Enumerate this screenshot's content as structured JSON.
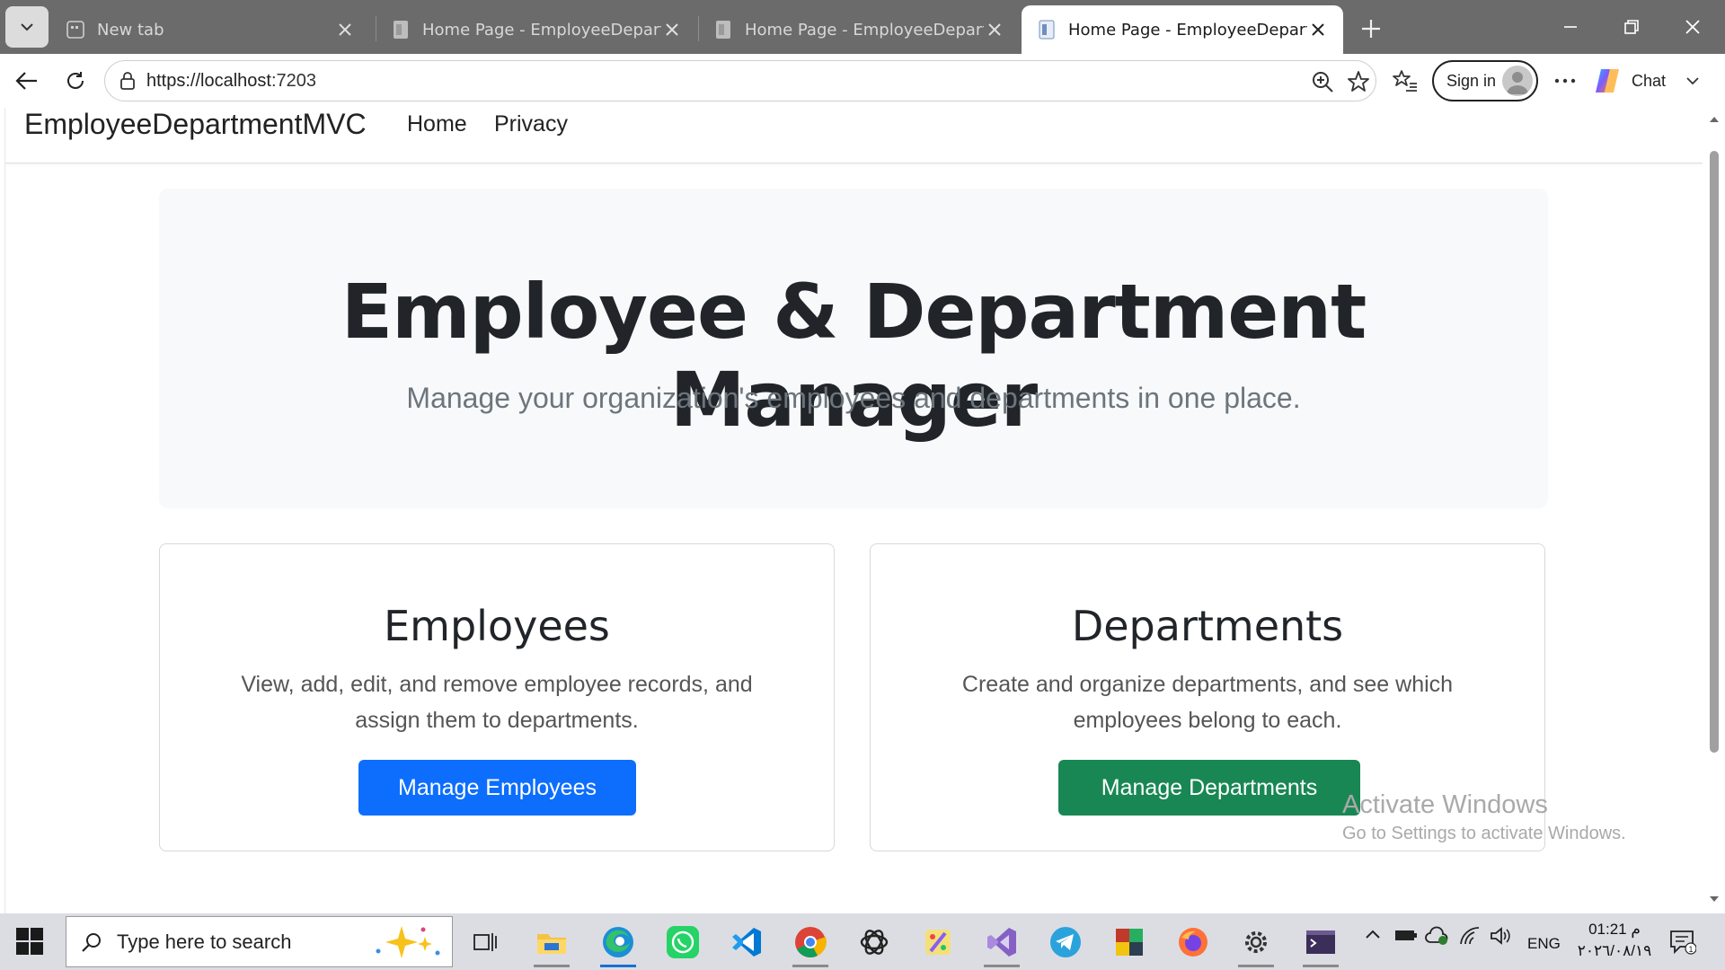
{
  "browser": {
    "tabs": [
      {
        "title": "New tab",
        "active": false
      },
      {
        "title": "Home Page - EmployeeDepartmen",
        "active": false
      },
      {
        "title": "Home Page - EmployeeDepartmen",
        "active": false
      },
      {
        "title": "Home Page - EmployeeDepartmen",
        "active": true
      }
    ],
    "url_host": "https://localhost",
    "url_port": ":7203",
    "signin_label": "Sign in",
    "chat_label": "Chat"
  },
  "site": {
    "brand": "EmployeeDepartmentMVC",
    "nav": [
      "Home",
      "Privacy"
    ]
  },
  "hero": {
    "title": "Employee & Department Manager",
    "subtitle": "Manage your organization's employees and departments in one place."
  },
  "cards": [
    {
      "title": "Employees",
      "description": "View, add, edit, and remove employee records, and assign them to departments.",
      "button": "Manage Employees",
      "button_color": "#0d6efd"
    },
    {
      "title": "Departments",
      "description": "Create and organize departments, and see which employees belong to each.",
      "button": "Manage Departments",
      "button_color": "#198754"
    }
  ],
  "watermark": {
    "line1": "Activate Windows",
    "line2": "Go to Settings to activate Windows."
  },
  "taskbar": {
    "search_placeholder": "Type here to search",
    "language": "ENG",
    "time": "01:21 م",
    "date": "٢٠٢٦/٠٨/١٩"
  }
}
